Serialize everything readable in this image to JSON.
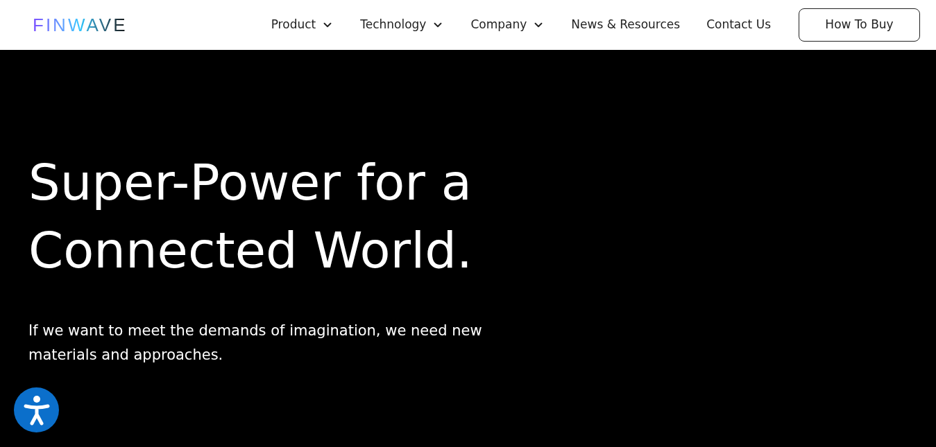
{
  "header": {
    "logo": "FINWAVE",
    "nav": [
      {
        "label": "Product",
        "has_menu": true
      },
      {
        "label": "Technology",
        "has_menu": true
      },
      {
        "label": "Company",
        "has_menu": true
      },
      {
        "label": "News & Resources",
        "has_menu": false
      },
      {
        "label": "Contact Us",
        "has_menu": false
      }
    ],
    "cta": "How To Buy"
  },
  "hero": {
    "title_lines": [
      "Super-Power for a",
      "Connected World."
    ],
    "subtitle": "If we want to meet the demands of imagination, we need new materials and approaches."
  }
}
